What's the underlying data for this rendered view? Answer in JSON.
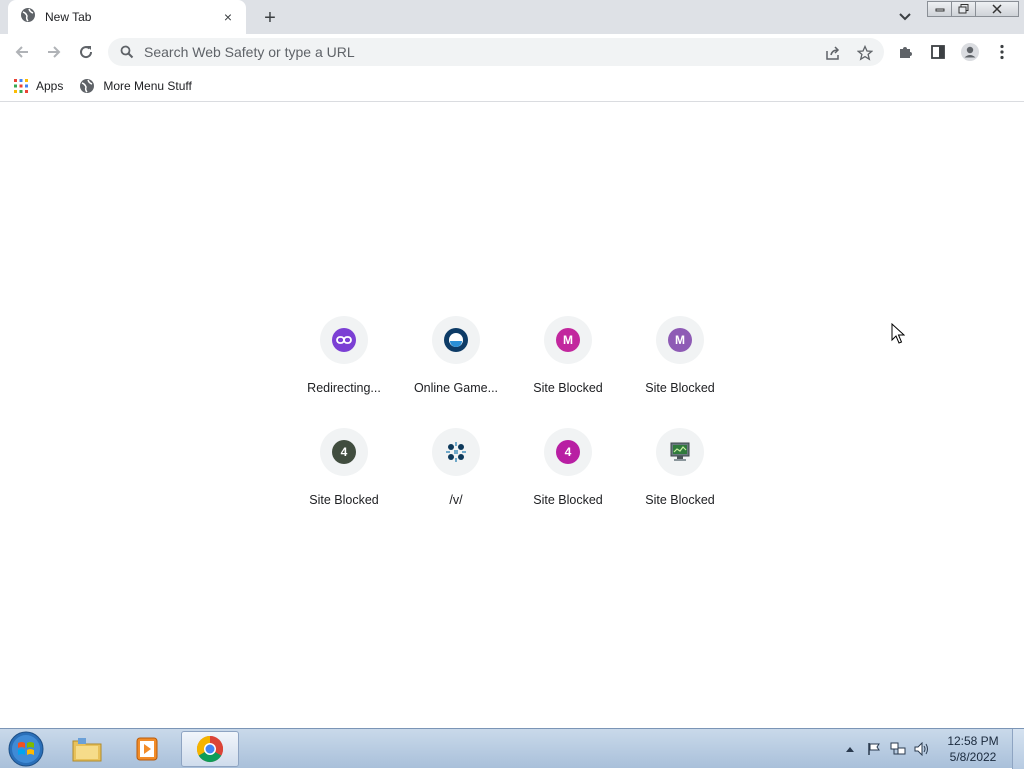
{
  "window": {
    "tab_title": "New Tab",
    "tab_close": "×",
    "new_tab": "+"
  },
  "toolbar": {
    "omnibox_placeholder": "Search Web Safety or type a URL"
  },
  "bookmarks": [
    {
      "label": "Apps",
      "icon": "apps-grid-icon"
    },
    {
      "label": "More Menu Stuff",
      "icon": "globe-icon"
    }
  ],
  "shortcuts": [
    {
      "title": "Redirecting...",
      "icon": "link-icon",
      "color": "#7b3fd4",
      "glyph": ""
    },
    {
      "title": "Online Game...",
      "icon": "ring-icon",
      "color": "#0d3b66",
      "glyph": ""
    },
    {
      "title": "Site Blocked",
      "icon": "letter-m-icon",
      "color": "#c2279e",
      "glyph": "M"
    },
    {
      "title": "Site Blocked",
      "icon": "letter-m-icon",
      "color": "#8e5bb5",
      "glyph": "M"
    },
    {
      "title": "Site Blocked",
      "icon": "number-4-icon",
      "color": "#414d3f",
      "glyph": "4"
    },
    {
      "title": "/v/",
      "icon": "clover-icon",
      "color": "#0e3a5c",
      "glyph": ""
    },
    {
      "title": "Site Blocked",
      "icon": "number-4-icon",
      "color": "#b81fa3",
      "glyph": "4"
    },
    {
      "title": "Site Blocked",
      "icon": "monitor-icon",
      "color": "#3c6e47",
      "glyph": ""
    }
  ],
  "taskbar": {
    "apps": [
      {
        "name": "file-explorer-icon",
        "active": false
      },
      {
        "name": "media-player-icon",
        "active": false
      },
      {
        "name": "chrome-icon",
        "active": true
      }
    ],
    "clock_time": "12:58 PM",
    "clock_date": "5/8/2022"
  }
}
